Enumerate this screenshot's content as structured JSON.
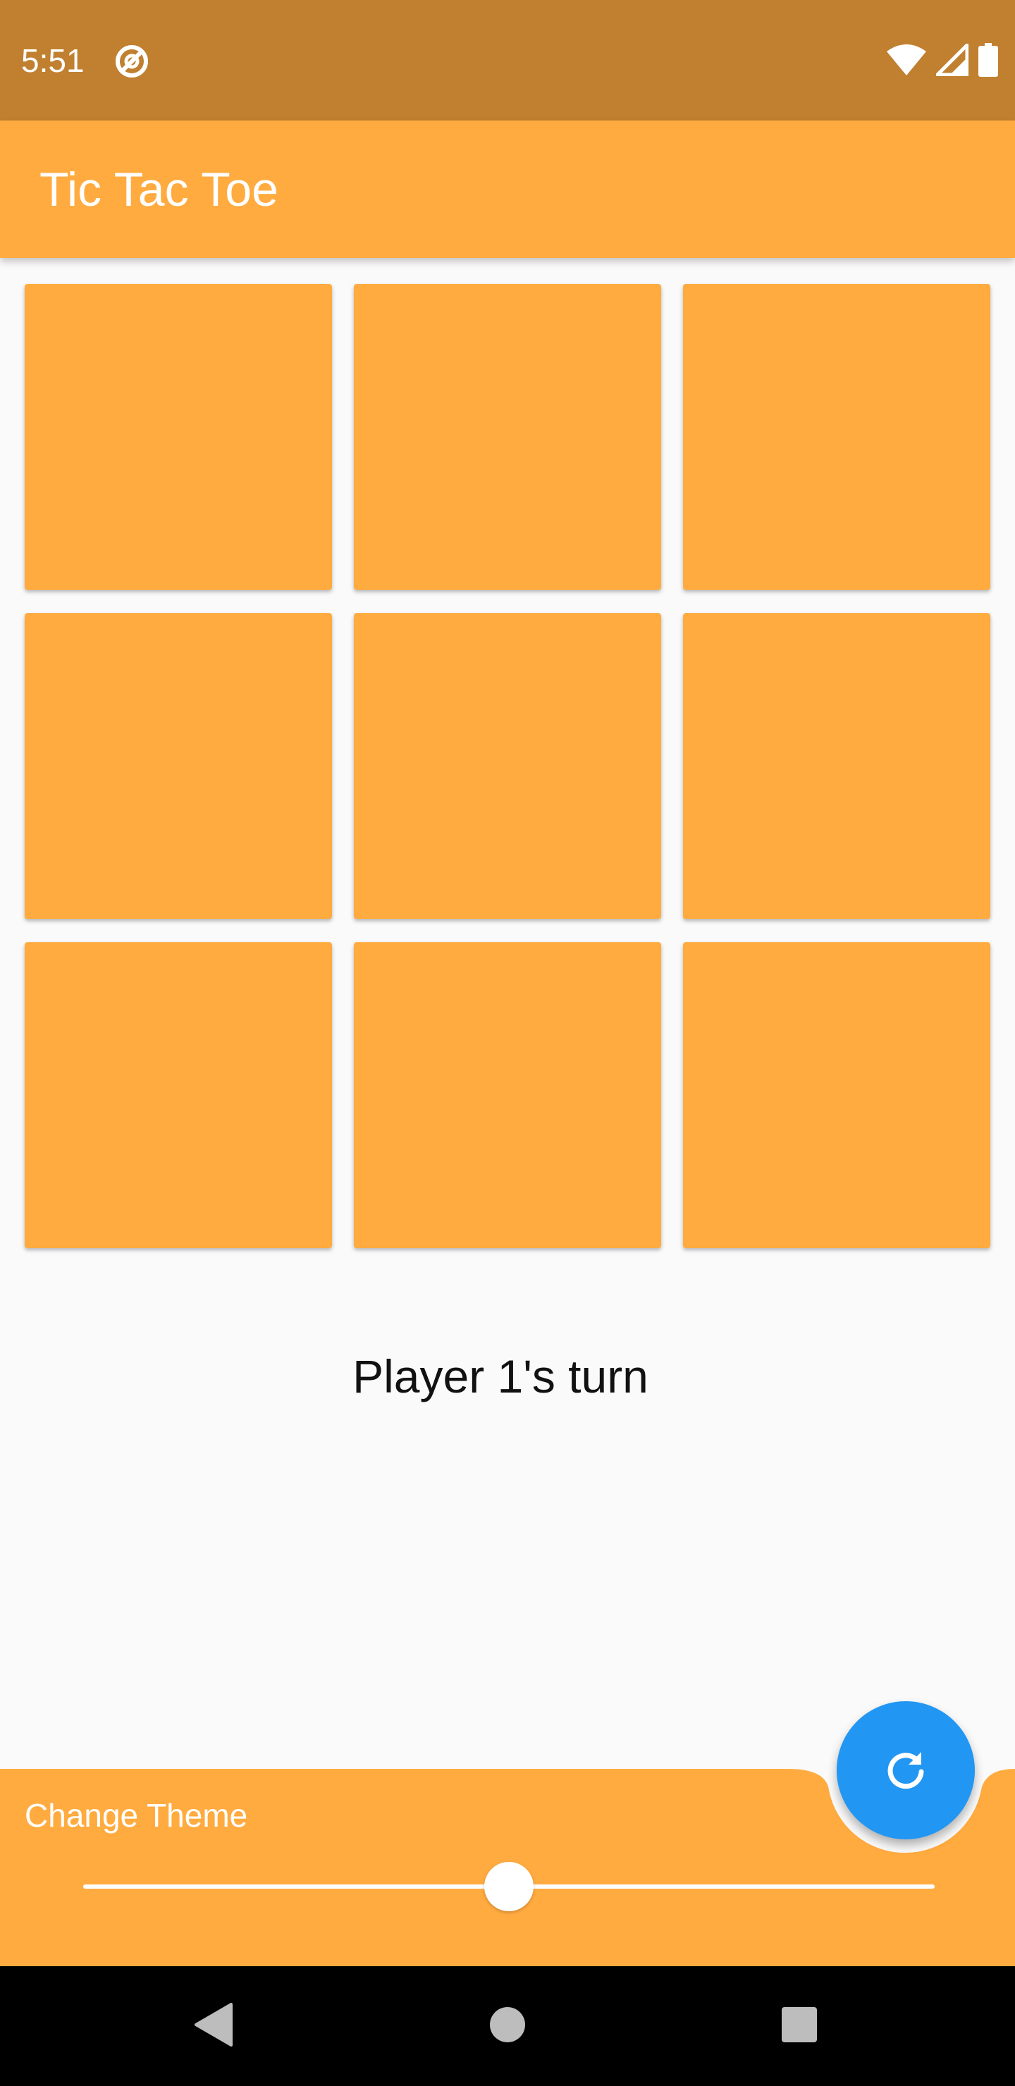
{
  "status_bar": {
    "time": "5:51",
    "notification_icon": "at-sign-icon",
    "wifi_icon": "wifi-icon",
    "signal_icon": "cell-signal-icon",
    "battery_icon": "battery-icon"
  },
  "app_bar": {
    "title": "Tic Tac Toe"
  },
  "board": {
    "cells": [
      "",
      "",
      "",
      "",
      "",
      "",
      "",
      "",
      ""
    ]
  },
  "game": {
    "status": "Player 1's turn"
  },
  "theme": {
    "label": "Change Theme",
    "slider_value": 0.5
  },
  "fab": {
    "icon": "refresh-icon"
  },
  "nav_bar": {
    "back_icon": "back-triangle-icon",
    "home_icon": "home-circle-icon",
    "recents_icon": "recents-square-icon"
  },
  "colors": {
    "status_bar": "#C08030",
    "primary": "#FFAB40",
    "accent": "#2196F3",
    "background": "#FAFAFA",
    "nav_bar": "#000000"
  }
}
